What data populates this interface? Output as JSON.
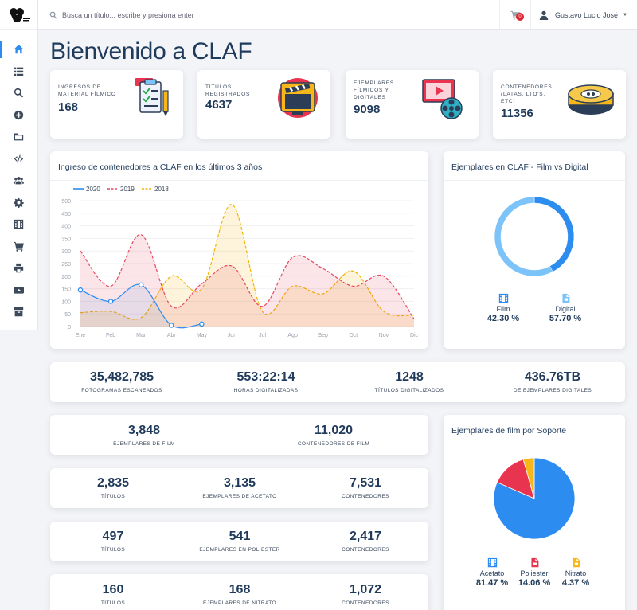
{
  "header": {
    "search_placeholder": "Busca un título... escribe y presiona enter",
    "cart_count": "0",
    "user_name": "Gustavo Lucio José"
  },
  "sidebar": {
    "items": [
      {
        "icon": "home-icon"
      },
      {
        "icon": "list-icon"
      },
      {
        "icon": "search-icon"
      },
      {
        "icon": "plus-circle-icon"
      },
      {
        "icon": "folder-icon"
      },
      {
        "icon": "code-icon"
      },
      {
        "icon": "users-icon"
      },
      {
        "icon": "gear-icon"
      },
      {
        "icon": "film-icon"
      },
      {
        "icon": "cart-icon"
      },
      {
        "icon": "print-icon"
      },
      {
        "icon": "youtube-icon"
      },
      {
        "icon": "archive-icon"
      }
    ]
  },
  "page_title": "Bienvenido a CLAF",
  "stats": [
    {
      "label": "INGRESOS DE MATERIAL FÍLMICO",
      "value": "168"
    },
    {
      "label": "TÍTULOS REGISTRADOS",
      "value": "4637"
    },
    {
      "label": "EJEMPLARES FÍLMICOS Y DIGITALES",
      "value": "9098"
    },
    {
      "label": "CONTENEDORES (LATAS, LTO'S, ETC)",
      "value": "11356"
    }
  ],
  "line_panel": {
    "title": "Ingreso de contenedores a CLAF en los últimos 3 años"
  },
  "chart_data": [
    {
      "type": "line",
      "title": "Ingreso de contenedores a CLAF en los últimos 3 años",
      "categories": [
        "Ene",
        "Feb",
        "Mar",
        "Abr",
        "May",
        "Jun",
        "Jul",
        "Ago",
        "Sep",
        "Oct",
        "Nov",
        "Dic"
      ],
      "ylim": [
        0,
        500
      ],
      "yticks": [
        0,
        50,
        100,
        150,
        200,
        250,
        300,
        350,
        400,
        450,
        500
      ],
      "grid": true,
      "legend": "top-left",
      "series": [
        {
          "name": "2020",
          "color": "#2d8cf0",
          "values": [
            145,
            100,
            165,
            5,
            10,
            null,
            null,
            null,
            null,
            null,
            null,
            null
          ]
        },
        {
          "name": "2019",
          "color": "#e9475f",
          "values": [
            300,
            160,
            365,
            80,
            170,
            240,
            80,
            275,
            230,
            160,
            200,
            30
          ]
        },
        {
          "name": "2018",
          "color": "#f4b400",
          "values": [
            55,
            60,
            35,
            200,
            150,
            485,
            60,
            160,
            130,
            220,
            60,
            45
          ]
        }
      ]
    },
    {
      "type": "pie",
      "title": "Ejemplares en CLAF - Film vs Digital",
      "categories": [
        "Film",
        "Digital"
      ],
      "values": [
        42.3,
        57.7
      ],
      "colors": [
        "#2d8cf0",
        "#7cc3fa"
      ]
    },
    {
      "type": "pie",
      "title": "Ejemplares de film por Soporte",
      "categories": [
        "Acetato",
        "Poliester",
        "Nitrato"
      ],
      "values": [
        81.47,
        14.06,
        4.37
      ],
      "colors": [
        "#2d8cf0",
        "#e9344f",
        "#f7b718"
      ]
    }
  ],
  "donut_panel": {
    "title": "Ejemplares en CLAF - Film vs Digital",
    "items": [
      {
        "label": "Film",
        "pct": "42.30 %",
        "icon": "film-icon",
        "color": "#2d8cf0"
      },
      {
        "label": "Digital",
        "pct": "57.70 %",
        "icon": "file-icon",
        "color": "#7cc3fa"
      }
    ]
  },
  "kpis_main": [
    {
      "value": "35,482,785",
      "label": "FOTOGRAMAS ESCANEADOS"
    },
    {
      "value": "553:22:14",
      "label": "HORAS DIGITALIZADAS"
    },
    {
      "value": "1248",
      "label": "TÍTULOS DIGITALIZADOS"
    },
    {
      "value": "436.76TB",
      "label": "DE EJEMPLARES DIGITALES"
    }
  ],
  "kpis_film": [
    {
      "value": "3,848",
      "label": "EJEMPLARES DE FILM"
    },
    {
      "value": "11,020",
      "label": "CONTENEDORES DE FILM"
    }
  ],
  "kpis_acetato": [
    {
      "value": "2,835",
      "label": "TÍTULOS"
    },
    {
      "value": "3,135",
      "label": "EJEMPLARES DE ACETATO"
    },
    {
      "value": "7,531",
      "label": "CONTENEDORES"
    }
  ],
  "kpis_poliester": [
    {
      "value": "497",
      "label": "TÍTULOS"
    },
    {
      "value": "541",
      "label": "EJEMPLARES EN POLIESTER"
    },
    {
      "value": "2,417",
      "label": "CONTENEDORES"
    }
  ],
  "kpis_nitrato": [
    {
      "value": "160",
      "label": "TÍTULOS"
    },
    {
      "value": "168",
      "label": "EJEMPLARES DE NITRATO"
    },
    {
      "value": "1,072",
      "label": "CONTENEDORES"
    }
  ],
  "soporte_panel": {
    "title": "Ejemplares de film por Soporte",
    "items": [
      {
        "label": "Acetato",
        "pct": "81.47 %",
        "icon": "film-icon",
        "color": "#2d8cf0"
      },
      {
        "label": "Poliester",
        "pct": "14.06 %",
        "icon": "file-icon",
        "color": "#e9344f"
      },
      {
        "label": "Nitrato",
        "pct": "4.37 %",
        "icon": "file-icon",
        "color": "#f7b718"
      }
    ]
  }
}
